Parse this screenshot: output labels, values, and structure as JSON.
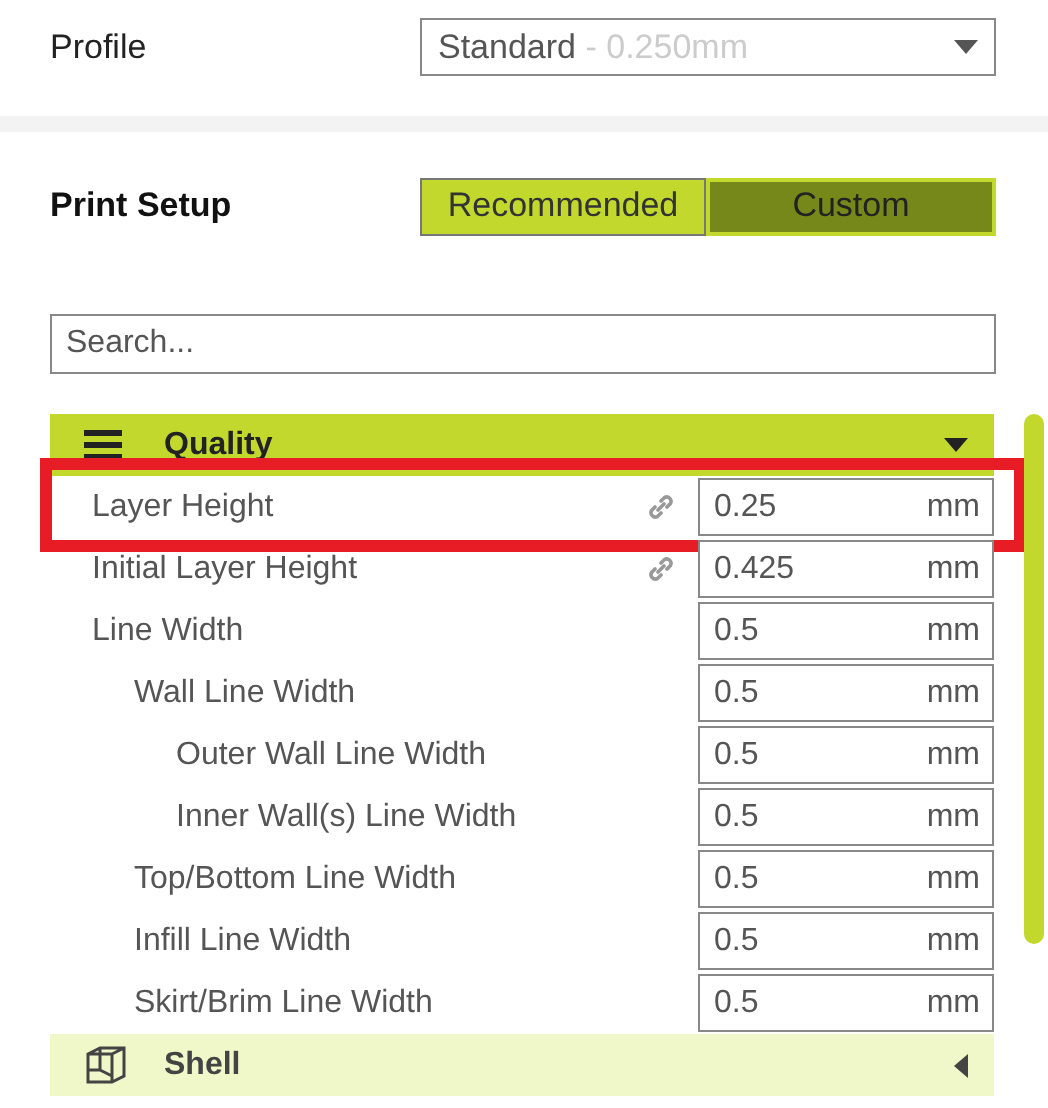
{
  "profile": {
    "label": "Profile",
    "value": "Standard",
    "detail": "- 0.250mm"
  },
  "print_setup": {
    "label": "Print Setup",
    "tabs": [
      {
        "label": "Recommended",
        "selected": false
      },
      {
        "label": "Custom",
        "selected": true
      }
    ]
  },
  "search": {
    "placeholder": "Search..."
  },
  "sections": [
    {
      "title": "Quality",
      "kind": "quality",
      "expanded": true,
      "settings": [
        {
          "label": "Layer Height",
          "value": "0.25",
          "unit": "mm",
          "linked": true,
          "highlighted": true
        },
        {
          "label": "Initial Layer Height",
          "value": "0.425",
          "unit": "mm",
          "linked": true,
          "highlighted": false
        },
        {
          "label": "Line Width",
          "value": "0.5",
          "unit": "mm",
          "linked": false,
          "highlighted": false,
          "children": [
            {
              "label": "Wall Line Width",
              "value": "0.5",
              "unit": "mm",
              "linked": false,
              "highlighted": false,
              "children": [
                {
                  "label": "Outer Wall Line Width",
                  "value": "0.5",
                  "unit": "mm",
                  "linked": false,
                  "highlighted": false
                },
                {
                  "label": "Inner Wall(s) Line Width",
                  "value": "0.5",
                  "unit": "mm",
                  "linked": false,
                  "highlighted": false
                }
              ]
            },
            {
              "label": "Top/Bottom Line Width",
              "value": "0.5",
              "unit": "mm",
              "linked": false,
              "highlighted": false
            },
            {
              "label": "Infill Line Width",
              "value": "0.5",
              "unit": "mm",
              "linked": false,
              "highlighted": false
            },
            {
              "label": "Skirt/Brim Line Width",
              "value": "0.5",
              "unit": "mm",
              "linked": false,
              "highlighted": false
            }
          ]
        }
      ]
    },
    {
      "title": "Shell",
      "kind": "shell",
      "expanded": false
    }
  ]
}
